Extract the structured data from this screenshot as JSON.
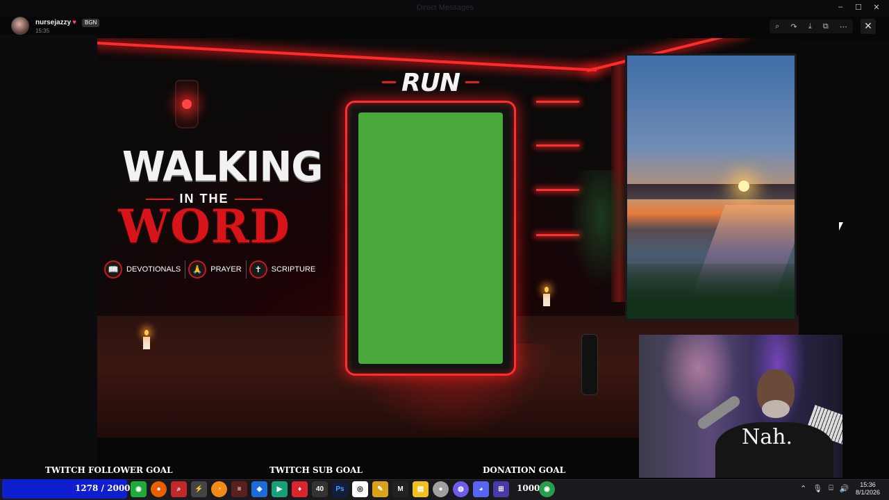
{
  "window": {
    "title": "Direct Messages",
    "controls": [
      "minimize",
      "maximize",
      "close"
    ]
  },
  "header": {
    "username": "nursejazzy",
    "badge": "BGN",
    "time": "15:35",
    "heart_icon": "heart-icon"
  },
  "viewer_tools": [
    "zoom-icon",
    "share-icon",
    "download-icon",
    "open-external-icon",
    "more-icon"
  ],
  "overlay": {
    "title_line1": "WALKING",
    "title_line2": "IN THE",
    "title_line3": "WORD",
    "topics": [
      {
        "label": "DEVOTIONALS",
        "icon": "book-icon"
      },
      {
        "label": "PRAYER",
        "icon": "praying-hands-icon"
      },
      {
        "label": "SCRIPTURE",
        "icon": "bible-icon"
      }
    ],
    "frame_label": "RUN",
    "webcam_shirt_text": "Nah."
  },
  "goals": {
    "follower_label": "TWITCH FOLLOWER GOAL",
    "follower_value": "1278 / 2000",
    "follower_progress": 0.639,
    "sub_label": "TWITCH SUB GOAL",
    "donation_label": "DONATION GOAL"
  },
  "taskbar": {
    "badge_count": "40",
    "count_value": "1000",
    "clock_time": "15:36",
    "clock_date": "8/1/2026",
    "colors": {
      "goal_bar": "#0f1fd0",
      "neon": "#ff2a2a",
      "green_screen": "#4aa93c"
    }
  }
}
